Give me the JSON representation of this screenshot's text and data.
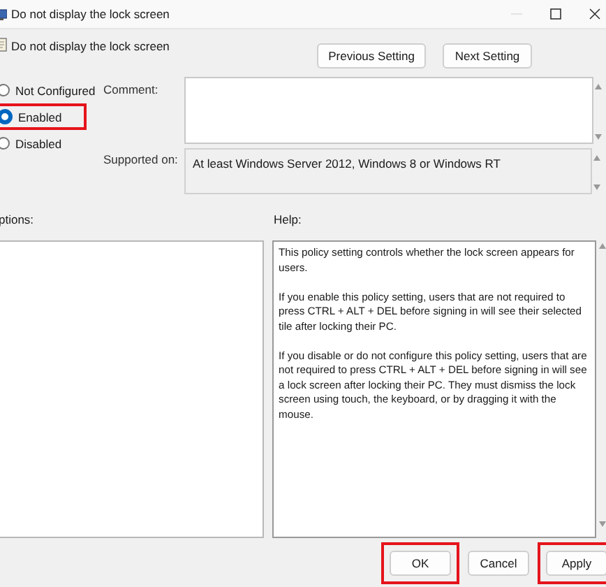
{
  "window": {
    "title": "Do not display the lock screen"
  },
  "header": {
    "title": "Do not display the lock screen",
    "buttons": [
      {
        "label": "Previous Setting",
        "highlighted": false
      },
      {
        "label": "Next Setting",
        "highlighted": false
      }
    ]
  },
  "state_options": [
    {
      "label": "Not Configured",
      "selected": false,
      "highlighted": false
    },
    {
      "label": "Enabled",
      "selected": true,
      "highlighted": true
    },
    {
      "label": "Disabled",
      "selected": false,
      "highlighted": false
    }
  ],
  "comment": {
    "label": "Comment:"
  },
  "supported_on": {
    "label": "Supported on:",
    "value": "At least Windows Server 2012, Windows 8 or Windows RT"
  },
  "options": {
    "label": "ptions:"
  },
  "help": {
    "label": "Help:",
    "paragraphs": [
      "This policy setting controls whether the lock screen appears for users.",
      "If you enable this policy setting, users that are not required to press CTRL + ALT + DEL before signing in will see their selected tile after locking their PC.",
      "If you disable or do not configure this policy setting, users that are not required to press CTRL + ALT + DEL before signing in will see a lock screen after locking their PC. They must dismiss the lock screen using touch, the keyboard, or by dragging it with the mouse."
    ]
  },
  "footer_buttons": [
    {
      "label": "OK",
      "highlighted": true
    },
    {
      "label": "Cancel",
      "highlighted": false
    },
    {
      "label": "Apply",
      "highlighted": true
    }
  ]
}
